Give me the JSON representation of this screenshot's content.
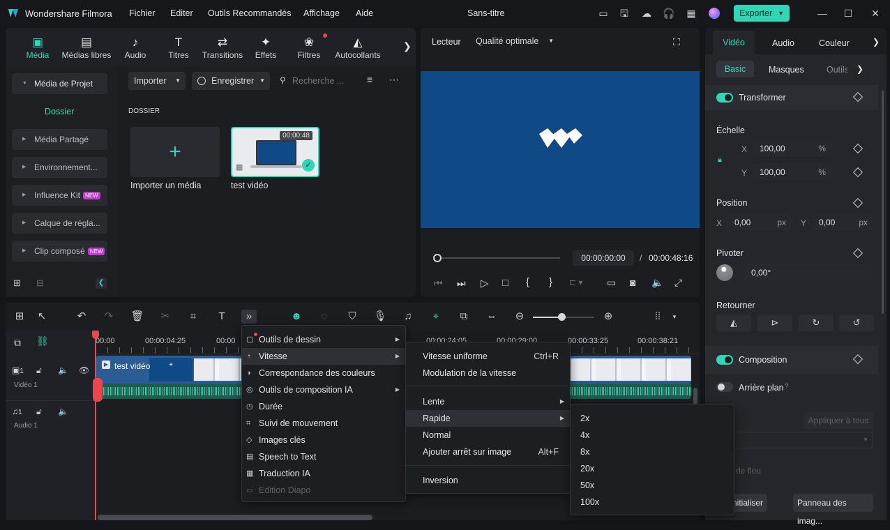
{
  "app": {
    "title": "Wondershare Filmora",
    "doc_title": "Sans-titre",
    "menus": [
      "Fichier",
      "Editer",
      "Outils Recommandés",
      "Affichage",
      "Aide"
    ],
    "export_label": "Exporter"
  },
  "toolbar": {
    "items": [
      {
        "label": "Média",
        "icon": "media-icon",
        "active": true
      },
      {
        "label": "Médias libres",
        "icon": "stock-media-icon"
      },
      {
        "label": "Audio",
        "icon": "music-note-icon"
      },
      {
        "label": "Titres",
        "icon": "text-t-icon"
      },
      {
        "label": "Transitions",
        "icon": "transitions-icon"
      },
      {
        "label": "Effets",
        "icon": "sparkle-icon"
      },
      {
        "label": "Filtres",
        "icon": "filters-icon"
      },
      {
        "label": "Autocollants",
        "icon": "sticker-icon"
      }
    ]
  },
  "sidebar": {
    "project_media": "Média de Projet",
    "folder": "Dossier",
    "items": [
      {
        "label": "Média Partagé"
      },
      {
        "label": "Environnement..."
      },
      {
        "label": "Influence Kit",
        "badge": "NEW"
      },
      {
        "label": "Calque de régla..."
      },
      {
        "label": "Clip composé",
        "badge": "NEW"
      }
    ]
  },
  "media": {
    "import_label": "Importer",
    "record_label": "Enregistrer",
    "search_placeholder": "Recherche ...",
    "folder_heading": "DOSSIER",
    "import_tile": "Importer un média",
    "clip": {
      "name": "test vidéo",
      "duration": "00:00:48"
    }
  },
  "player": {
    "tab": "Lecteur",
    "quality": "Qualité optimale",
    "current_time": "00:00:00:00",
    "separator": "/",
    "total_time": "00:00:48:16"
  },
  "inspector": {
    "tabs": [
      "Vidéo",
      "Audio",
      "Couleur"
    ],
    "subtabs": [
      "Basic",
      "Masques",
      "Outils"
    ],
    "transform": "Transformer",
    "scale": "Échelle",
    "scale_x": "100,00",
    "scale_y": "100,00",
    "percent": "%",
    "position": "Position",
    "pos_x": "0,00",
    "pos_y": "0,00",
    "px": "px",
    "rotate": "Pivoter",
    "rotate_val": "0,00°",
    "flip": "Retourner",
    "composition": "Composition",
    "background": "Arrière plan",
    "apply_all": "Appliquer à tous",
    "blur_label": "de flou",
    "reset": "nitialiser",
    "panel_btn": "Panneau des imag...",
    "dropdown_partial": "u"
  },
  "timeline": {
    "ruler": [
      "00:00",
      "00:00:04:25",
      "00:00",
      "00:00:24:05",
      "00:00:29:00",
      "00:00:33:25",
      "00:00:38:21"
    ],
    "video_track": "Vidéo 1",
    "audio_track": "Audio 1",
    "clip_title": "test vidéo",
    "track_num": "1"
  },
  "context_menu": {
    "items": [
      {
        "label": "Outils de dessin",
        "arrow": true
      },
      {
        "label": "Vitesse",
        "arrow": true
      },
      {
        "label": "Correspondance des couleurs"
      },
      {
        "label": "Outils de composition IA",
        "arrow": true
      },
      {
        "label": "Durée"
      },
      {
        "label": "Suivi de mouvement"
      },
      {
        "label": "Images clés"
      },
      {
        "label": "Speech to Text"
      },
      {
        "label": "Traduction IA"
      },
      {
        "label": "Edition Diapo"
      }
    ]
  },
  "speed_menu": {
    "items": [
      {
        "label": "Vitesse uniforme",
        "shortcut": "Ctrl+R"
      },
      {
        "label": "Modulation de la vitesse"
      },
      {
        "label": "Lente"
      },
      {
        "label": "Rapide"
      },
      {
        "label": "Normal"
      },
      {
        "label": "Ajouter arrêt sur image",
        "shortcut": "Alt+F"
      },
      {
        "label": "Inversion"
      }
    ]
  },
  "fast_menu": {
    "items": [
      "2x",
      "4x",
      "8x",
      "20x",
      "50x",
      "100x"
    ]
  },
  "colors": {
    "accent": "#2fd7b6",
    "preview_bg": "#0f4a87",
    "playhead": "#e8474f"
  }
}
